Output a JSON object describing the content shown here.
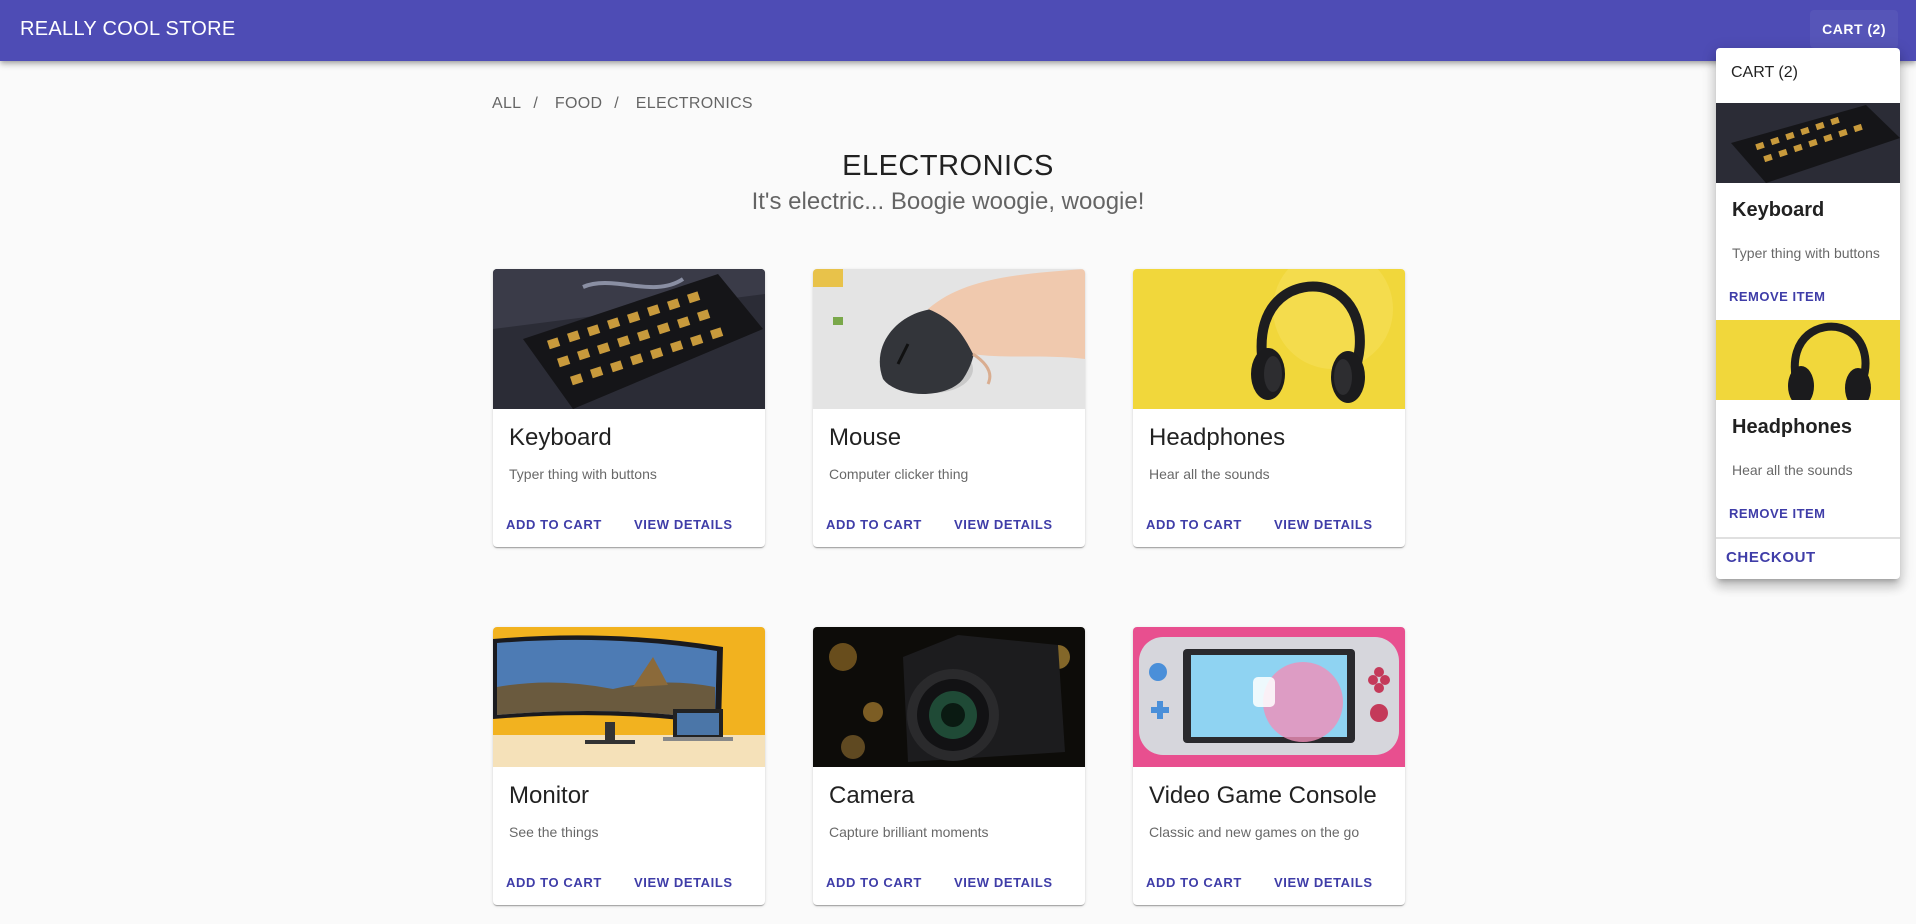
{
  "app": {
    "title": "REALLY COOL STORE",
    "cart_button": "CART (2)"
  },
  "breadcrumb": [
    {
      "label": "ALL",
      "sep": "/"
    },
    {
      "label": "FOOD",
      "sep": "/"
    },
    {
      "label": "ELECTRONICS",
      "sep": ""
    }
  ],
  "page": {
    "title": "ELECTRONICS",
    "subtitle": "It's electric... Boogie woogie, woogie!"
  },
  "product_actions": {
    "add": "ADD TO CART",
    "view": "VIEW DETAILS"
  },
  "products": [
    {
      "name": "Keyboard",
      "description": "Typer thing with buttons",
      "image": "keyboard"
    },
    {
      "name": "Mouse",
      "description": "Computer clicker thing",
      "image": "mouse"
    },
    {
      "name": "Headphones",
      "description": "Hear all the sounds",
      "image": "headphones"
    },
    {
      "name": "Monitor",
      "description": "See the things",
      "image": "monitor"
    },
    {
      "name": "Camera",
      "description": "Capture brilliant moments",
      "image": "camera"
    },
    {
      "name": "Video Game Console",
      "description": "Classic and new games on the go",
      "image": "console"
    }
  ],
  "cart": {
    "header": "CART (2)",
    "items": [
      {
        "name": "Keyboard",
        "description": "Typer thing with buttons",
        "remove_label": "REMOVE ITEM",
        "image": "keyboard"
      },
      {
        "name": "Headphones",
        "description": "Hear all the sounds",
        "remove_label": "REMOVE ITEM",
        "image": "headphones"
      }
    ],
    "checkout_label": "CHECKOUT"
  },
  "colors": {
    "primary": "#4e4cb5",
    "accent_text": "#3f3da8",
    "background": "#fafafa"
  }
}
